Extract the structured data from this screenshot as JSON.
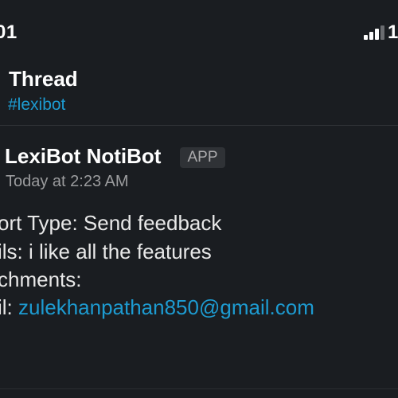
{
  "status_bar": {
    "time": "01",
    "extra": "1",
    "signal_icon": "signal-bars-icon"
  },
  "header": {
    "title": "Thread",
    "channel": "#lexibot"
  },
  "message": {
    "sender": "LexiBot NotiBot",
    "badge": "APP",
    "timestamp": "Today at 2:23 AM",
    "lines": [
      "ort Type: Send feedback",
      "ils: i like all the features",
      "chments:"
    ],
    "email_prefix": "il: ",
    "email": "zulekhanpathan850@gmail.com"
  },
  "colors": {
    "background": "#1a1d21",
    "link": "#1d9bd1",
    "text": "#e8e8e8",
    "muted": "#9b9c9e"
  }
}
